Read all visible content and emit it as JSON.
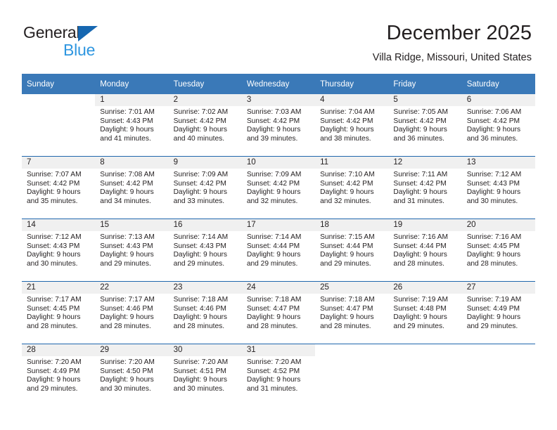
{
  "brand": {
    "name_top": "General",
    "name_bottom": "Blue",
    "triangle_color": "#1667b1",
    "blue_text_color": "#2e96e0"
  },
  "header": {
    "title": "December 2025",
    "subtitle": "Villa Ridge, Missouri, United States"
  },
  "colors": {
    "header_blue": "#3a79b8",
    "row_separator_blue": "#1f66ad",
    "daynum_band_gray": "#f0f0f0",
    "text": "#231f20"
  },
  "weekday_headers": [
    "Sunday",
    "Monday",
    "Tuesday",
    "Wednesday",
    "Thursday",
    "Friday",
    "Saturday"
  ],
  "weeks": [
    [
      {
        "day": "",
        "sunrise": "",
        "sunset": "",
        "daylight": "",
        "empty": true
      },
      {
        "day": "1",
        "sunrise": "Sunrise: 7:01 AM",
        "sunset": "Sunset: 4:43 PM",
        "daylight": "Daylight: 9 hours and 41 minutes."
      },
      {
        "day": "2",
        "sunrise": "Sunrise: 7:02 AM",
        "sunset": "Sunset: 4:42 PM",
        "daylight": "Daylight: 9 hours and 40 minutes."
      },
      {
        "day": "3",
        "sunrise": "Sunrise: 7:03 AM",
        "sunset": "Sunset: 4:42 PM",
        "daylight": "Daylight: 9 hours and 39 minutes."
      },
      {
        "day": "4",
        "sunrise": "Sunrise: 7:04 AM",
        "sunset": "Sunset: 4:42 PM",
        "daylight": "Daylight: 9 hours and 38 minutes."
      },
      {
        "day": "5",
        "sunrise": "Sunrise: 7:05 AM",
        "sunset": "Sunset: 4:42 PM",
        "daylight": "Daylight: 9 hours and 36 minutes."
      },
      {
        "day": "6",
        "sunrise": "Sunrise: 7:06 AM",
        "sunset": "Sunset: 4:42 PM",
        "daylight": "Daylight: 9 hours and 36 minutes."
      }
    ],
    [
      {
        "day": "7",
        "sunrise": "Sunrise: 7:07 AM",
        "sunset": "Sunset: 4:42 PM",
        "daylight": "Daylight: 9 hours and 35 minutes."
      },
      {
        "day": "8",
        "sunrise": "Sunrise: 7:08 AM",
        "sunset": "Sunset: 4:42 PM",
        "daylight": "Daylight: 9 hours and 34 minutes."
      },
      {
        "day": "9",
        "sunrise": "Sunrise: 7:09 AM",
        "sunset": "Sunset: 4:42 PM",
        "daylight": "Daylight: 9 hours and 33 minutes."
      },
      {
        "day": "10",
        "sunrise": "Sunrise: 7:09 AM",
        "sunset": "Sunset: 4:42 PM",
        "daylight": "Daylight: 9 hours and 32 minutes."
      },
      {
        "day": "11",
        "sunrise": "Sunrise: 7:10 AM",
        "sunset": "Sunset: 4:42 PM",
        "daylight": "Daylight: 9 hours and 32 minutes."
      },
      {
        "day": "12",
        "sunrise": "Sunrise: 7:11 AM",
        "sunset": "Sunset: 4:42 PM",
        "daylight": "Daylight: 9 hours and 31 minutes."
      },
      {
        "day": "13",
        "sunrise": "Sunrise: 7:12 AM",
        "sunset": "Sunset: 4:43 PM",
        "daylight": "Daylight: 9 hours and 30 minutes."
      }
    ],
    [
      {
        "day": "14",
        "sunrise": "Sunrise: 7:12 AM",
        "sunset": "Sunset: 4:43 PM",
        "daylight": "Daylight: 9 hours and 30 minutes."
      },
      {
        "day": "15",
        "sunrise": "Sunrise: 7:13 AM",
        "sunset": "Sunset: 4:43 PM",
        "daylight": "Daylight: 9 hours and 29 minutes."
      },
      {
        "day": "16",
        "sunrise": "Sunrise: 7:14 AM",
        "sunset": "Sunset: 4:43 PM",
        "daylight": "Daylight: 9 hours and 29 minutes."
      },
      {
        "day": "17",
        "sunrise": "Sunrise: 7:14 AM",
        "sunset": "Sunset: 4:44 PM",
        "daylight": "Daylight: 9 hours and 29 minutes."
      },
      {
        "day": "18",
        "sunrise": "Sunrise: 7:15 AM",
        "sunset": "Sunset: 4:44 PM",
        "daylight": "Daylight: 9 hours and 29 minutes."
      },
      {
        "day": "19",
        "sunrise": "Sunrise: 7:16 AM",
        "sunset": "Sunset: 4:44 PM",
        "daylight": "Daylight: 9 hours and 28 minutes."
      },
      {
        "day": "20",
        "sunrise": "Sunrise: 7:16 AM",
        "sunset": "Sunset: 4:45 PM",
        "daylight": "Daylight: 9 hours and 28 minutes."
      }
    ],
    [
      {
        "day": "21",
        "sunrise": "Sunrise: 7:17 AM",
        "sunset": "Sunset: 4:45 PM",
        "daylight": "Daylight: 9 hours and 28 minutes."
      },
      {
        "day": "22",
        "sunrise": "Sunrise: 7:17 AM",
        "sunset": "Sunset: 4:46 PM",
        "daylight": "Daylight: 9 hours and 28 minutes."
      },
      {
        "day": "23",
        "sunrise": "Sunrise: 7:18 AM",
        "sunset": "Sunset: 4:46 PM",
        "daylight": "Daylight: 9 hours and 28 minutes."
      },
      {
        "day": "24",
        "sunrise": "Sunrise: 7:18 AM",
        "sunset": "Sunset: 4:47 PM",
        "daylight": "Daylight: 9 hours and 28 minutes."
      },
      {
        "day": "25",
        "sunrise": "Sunrise: 7:18 AM",
        "sunset": "Sunset: 4:47 PM",
        "daylight": "Daylight: 9 hours and 28 minutes."
      },
      {
        "day": "26",
        "sunrise": "Sunrise: 7:19 AM",
        "sunset": "Sunset: 4:48 PM",
        "daylight": "Daylight: 9 hours and 29 minutes."
      },
      {
        "day": "27",
        "sunrise": "Sunrise: 7:19 AM",
        "sunset": "Sunset: 4:49 PM",
        "daylight": "Daylight: 9 hours and 29 minutes."
      }
    ],
    [
      {
        "day": "28",
        "sunrise": "Sunrise: 7:20 AM",
        "sunset": "Sunset: 4:49 PM",
        "daylight": "Daylight: 9 hours and 29 minutes."
      },
      {
        "day": "29",
        "sunrise": "Sunrise: 7:20 AM",
        "sunset": "Sunset: 4:50 PM",
        "daylight": "Daylight: 9 hours and 30 minutes."
      },
      {
        "day": "30",
        "sunrise": "Sunrise: 7:20 AM",
        "sunset": "Sunset: 4:51 PM",
        "daylight": "Daylight: 9 hours and 30 minutes."
      },
      {
        "day": "31",
        "sunrise": "Sunrise: 7:20 AM",
        "sunset": "Sunset: 4:52 PM",
        "daylight": "Daylight: 9 hours and 31 minutes."
      },
      {
        "day": "",
        "sunrise": "",
        "sunset": "",
        "daylight": "",
        "empty": true
      },
      {
        "day": "",
        "sunrise": "",
        "sunset": "",
        "daylight": "",
        "empty": true
      },
      {
        "day": "",
        "sunrise": "",
        "sunset": "",
        "daylight": "",
        "empty": true
      }
    ]
  ]
}
